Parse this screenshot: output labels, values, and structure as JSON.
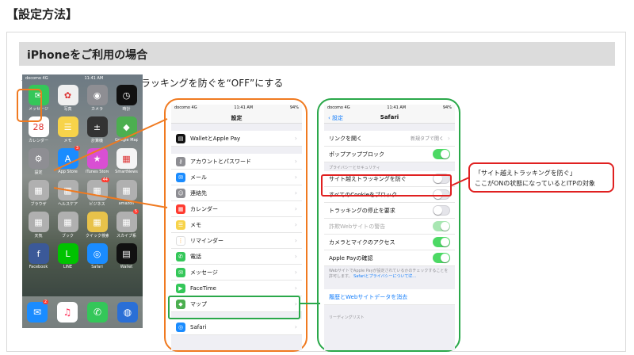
{
  "section_title": "【設定方法】",
  "subheading": "iPhoneをご利用の場合",
  "instruction": "設定→Safari→サイト越えトラッキングを防ぐを“OFF”にする",
  "home_screen": {
    "status": {
      "carrier": "docomo  4G",
      "time": "11:41 AM"
    },
    "apps": [
      {
        "name": "メッセージ",
        "icon": "message-icon",
        "glyph": "✉",
        "color": "#34c759"
      },
      {
        "name": "写真",
        "icon": "photos-icon",
        "glyph": "✿",
        "color": "#f0f0f0"
      },
      {
        "name": "カメラ",
        "icon": "camera-icon",
        "glyph": "◉",
        "color": "#8e8e93"
      },
      {
        "name": "時計",
        "icon": "clock-icon",
        "glyph": "◷",
        "color": "#111111"
      },
      {
        "name": "カレンダー",
        "icon": "calendar-icon",
        "glyph": "28",
        "color": "#ffffff"
      },
      {
        "name": "メモ",
        "icon": "notes-icon",
        "glyph": "☰",
        "color": "#f7d34a"
      },
      {
        "name": "計算機",
        "icon": "calculator-icon",
        "glyph": "±",
        "color": "#333333"
      },
      {
        "name": "Google Maps",
        "icon": "google-maps-icon",
        "glyph": "◆",
        "color": "#4caf50"
      },
      {
        "name": "設定",
        "icon": "settings-gear-icon",
        "glyph": "⚙",
        "color": "#8e8e93"
      },
      {
        "name": "App Store",
        "icon": "app-store-icon",
        "glyph": "A",
        "color": "#1a8cff",
        "badge": "3"
      },
      {
        "name": "iTunes Store",
        "icon": "itunes-store-icon",
        "glyph": "★",
        "color": "#d94fd3"
      },
      {
        "name": "SmartNews",
        "icon": "smartnews-icon",
        "glyph": "▦",
        "color": "#f5f5f5"
      },
      {
        "name": "ブラウザ",
        "icon": "browser-folder-icon",
        "glyph": "▦",
        "color": "#b0b0b0"
      },
      {
        "name": "ヘルスケア",
        "icon": "health-folder-icon",
        "glyph": "▦",
        "color": "#b0b0b0"
      },
      {
        "name": "ビジネス",
        "icon": "business-folder-icon",
        "glyph": "▦",
        "color": "#b0b0b0",
        "badge": "44"
      },
      {
        "name": "amazon",
        "icon": "amazon-folder-icon",
        "glyph": "▦",
        "color": "#b0b0b0"
      },
      {
        "name": "天気",
        "icon": "weather-folder-icon",
        "glyph": "▦",
        "color": "#b0b0b0"
      },
      {
        "name": "ブック",
        "icon": "books-folder-icon",
        "glyph": "▦",
        "color": "#b0b0b0"
      },
      {
        "name": "クイック検索",
        "icon": "quick-search-icon",
        "glyph": "▦",
        "color": "#e8c24a"
      },
      {
        "name": "スカイプ系",
        "icon": "skype-folder-icon",
        "glyph": "▦",
        "color": "#b0b0b0",
        "badge": "5"
      },
      {
        "name": "Facebook",
        "icon": "facebook-icon",
        "glyph": "f",
        "color": "#3b5998"
      },
      {
        "name": "LINE",
        "icon": "line-icon",
        "glyph": "L",
        "color": "#00c300"
      },
      {
        "name": "Safari",
        "icon": "safari-compass-icon",
        "glyph": "◎",
        "color": "#1a8cff"
      },
      {
        "name": "Wallet",
        "icon": "wallet-icon",
        "glyph": "▤",
        "color": "#111111"
      }
    ],
    "dock": [
      {
        "icon": "mail-icon",
        "glyph": "✉",
        "color": "#1a8cff",
        "badge": "2"
      },
      {
        "icon": "music-icon",
        "glyph": "♫",
        "color": "#ffffff"
      },
      {
        "icon": "phone-icon",
        "glyph": "✆",
        "color": "#34c759"
      },
      {
        "icon": "globe-icon",
        "glyph": "◍",
        "color": "#2a6fd6"
      }
    ]
  },
  "settings_screen": {
    "status": {
      "carrier": "docomo  4G",
      "time": "11:41 AM",
      "battery": "94%"
    },
    "title": "設定",
    "rows": [
      {
        "label": "WalletとApple Pay",
        "icon": "wallet-icon",
        "color": "#111111",
        "glyph": "▤"
      },
      {
        "label": "アカウントとパスワード",
        "icon": "key-icon",
        "color": "#8e8e93",
        "glyph": "⚷"
      },
      {
        "label": "メール",
        "icon": "mail-icon",
        "color": "#1a8cff",
        "glyph": "✉"
      },
      {
        "label": "連絡先",
        "icon": "contacts-icon",
        "color": "#8e8e93",
        "glyph": "☺"
      },
      {
        "label": "カレンダー",
        "icon": "calendar-icon",
        "color": "#ff3b30",
        "glyph": "▦"
      },
      {
        "label": "メモ",
        "icon": "notes-icon",
        "color": "#f7d34a",
        "glyph": "☰"
      },
      {
        "label": "リマインダー",
        "icon": "reminders-icon",
        "color": "#ffffff",
        "glyph": "⋮"
      },
      {
        "label": "電話",
        "icon": "phone-icon",
        "color": "#34c759",
        "glyph": "✆"
      },
      {
        "label": "メッセージ",
        "icon": "message-icon",
        "color": "#34c759",
        "glyph": "✉"
      },
      {
        "label": "FaceTime",
        "icon": "facetime-icon",
        "color": "#34c759",
        "glyph": "▶"
      },
      {
        "label": "マップ",
        "icon": "maps-icon",
        "color": "#4caf50",
        "glyph": "◆"
      },
      {
        "label": "Safari",
        "icon": "safari-compass-icon",
        "color": "#1a8cff",
        "glyph": "◎"
      }
    ]
  },
  "safari_screen": {
    "status": {
      "carrier": "docomo  4G",
      "time": "11:41 AM",
      "battery": "94%"
    },
    "back_label": "設定",
    "title": "Safari",
    "rows": [
      {
        "label": "リンクを開く",
        "value": "新規タブで開く"
      },
      {
        "label": "ポップアップブロック",
        "toggle": "on"
      },
      {
        "label": "サイト越えトラッキングを防ぐ",
        "toggle": "off"
      },
      {
        "label": "すべてのCookieをブロック",
        "toggle": "off"
      },
      {
        "label": "トラッキングの停止を要求",
        "toggle": "off"
      },
      {
        "label": "詐欺Webサイトの警告",
        "toggle": "dim"
      },
      {
        "label": "カメラとマイクのアクセス",
        "toggle": "on"
      },
      {
        "label": "Apple Payの確認",
        "toggle": "on"
      }
    ],
    "privacy_header": "プライバシーとセキュリティ",
    "footnote": "WebサイトでApple Payが設定されているかのチェックすることを許可します。",
    "footnote_link": "SafariとプライバシーについてĭŹ…",
    "clear_history": "履歴とWebサイトデータを消去",
    "reading_list_header": "リーディングリスト"
  },
  "callout": {
    "line1": "「サイト越えトラッキングを防ぐ」",
    "line2": "ここがONの状態になっているとITPの対象"
  },
  "colors": {
    "orange": "#f07a20",
    "green": "#2aa84a",
    "red": "#e02020"
  }
}
